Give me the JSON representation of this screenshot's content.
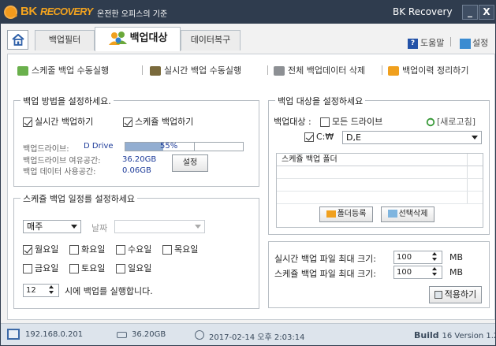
{
  "titlebar": {
    "brand": "BK",
    "brand_sub": "RECOVERY",
    "tagline": "온전한 오피스의 기준",
    "app_name": "BK Recovery",
    "minimize": "_",
    "close": "X"
  },
  "tabs": {
    "backup_filter": "백업필터",
    "backup_target": "백업대상",
    "data_recover": "데이터복구",
    "help": "도움말",
    "settings": "설정"
  },
  "toolbar": {
    "schedule_manual": "스케줄 백업 수동실행",
    "realtime_manual": "실시간 백업 수동실행",
    "delete_all": "전체 백업데이터 삭제",
    "cleanup_history": "백업이력 정리하기"
  },
  "backup_method": {
    "title": "백업 방법을 설정하세요.",
    "realtime_label": "실시간 백업하기",
    "realtime_checked": true,
    "schedule_label": "스케쥴 백업하기",
    "schedule_checked": true,
    "drive_label": "백업드라이브:",
    "drive_value": "D Drive",
    "usage_percent": 55,
    "usage_text": "55%",
    "free_label": "백업드라이브 여유공간:",
    "free_value": "36.20GB",
    "used_label": "백업 데이터  사용공간:",
    "used_value": "0.06GB",
    "settings_button": "설정"
  },
  "schedule": {
    "title": "스케쥴 백업 일정를 설정하세요",
    "period": "매주",
    "date_label": "날짜",
    "days": [
      {
        "label": "월요일",
        "checked": true
      },
      {
        "label": "화요일",
        "checked": false
      },
      {
        "label": "수요일",
        "checked": false
      },
      {
        "label": "목요일",
        "checked": false
      },
      {
        "label": "금요일",
        "checked": false
      },
      {
        "label": "토요일",
        "checked": false
      },
      {
        "label": "일요일",
        "checked": false
      }
    ],
    "hour": "12",
    "hour_suffix": "시에 백업를 실행합니다."
  },
  "backup_target": {
    "title": "백업 대상을 설정하세요",
    "target_label": "백업대상 :",
    "all_drives_label": "모든 드라이브",
    "all_drives_checked": false,
    "refresh_label": "[새로고침]",
    "c_drive_label": "C:₩",
    "c_drive_checked": true,
    "drive_select": "D,E",
    "folder_header": "스케쥴 백업 폴더",
    "add_folder": "폴더등록",
    "delete_selected": "선택삭제"
  },
  "size_limits": {
    "realtime_label": "실시간 백업 파일 최대 크기:",
    "realtime_value": "100",
    "realtime_unit": "MB",
    "schedule_label": "스케쥴 백업 파일 최대 크기:",
    "schedule_value": "100",
    "schedule_unit": "MB",
    "apply_button": "적용하기"
  },
  "statusbar": {
    "ip": "192.168.0.201",
    "disk": "36.20GB",
    "datetime": "2017-02-14 오후 2:03:14",
    "build_label": "Build",
    "build_version": "16 Version 1.2"
  },
  "colors": {
    "titlebar": "#2f3c4e",
    "brand": "#f3a31f",
    "accent_blue": "#1e3c9a",
    "statusbar": "#dde4ec"
  }
}
